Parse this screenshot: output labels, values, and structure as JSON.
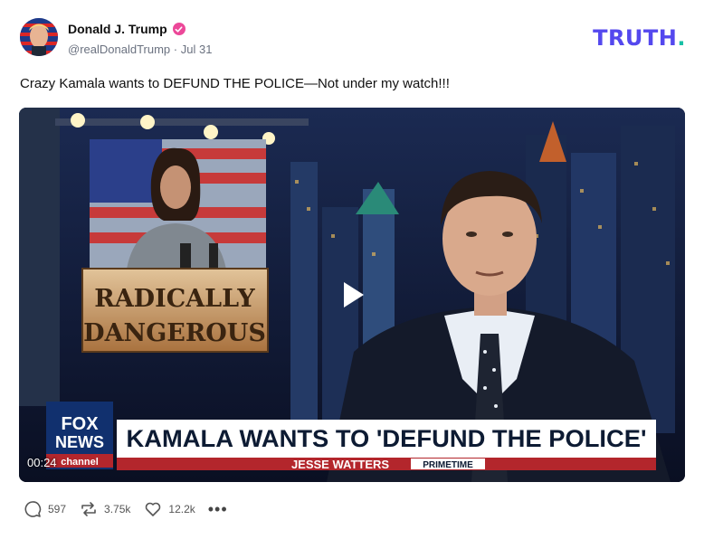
{
  "author": {
    "display_name": "Donald J. Trump",
    "handle": "@realDonaldTrump",
    "separator": "·",
    "date": "Jul 31"
  },
  "brand": {
    "wordmark": "TRUTH",
    "dot": "."
  },
  "post": {
    "text": "Crazy Kamala wants to DEFUND THE POLICE—Not under my watch!!!"
  },
  "video": {
    "duration": "00:24",
    "sign_line1": "RADICALLY",
    "sign_line2": "DANGEROUS",
    "network_line1": "FOX",
    "network_line2": "NEWS",
    "network_line3": "channel",
    "headline": "KAMALA WANTS TO 'DEFUND THE POLICE'",
    "show_name": "JESSE WATTERS",
    "show_tag": "PRIMETIME"
  },
  "engagement": {
    "replies": "597",
    "retruths": "3.75k",
    "likes": "12.2k",
    "more": "•••"
  },
  "colors": {
    "brand_purple": "#5448ee",
    "brand_teal": "#18c0a6",
    "verified_pink": "#ec4899"
  },
  "icons": [
    "verified-badge-icon",
    "play-icon",
    "reply-icon",
    "retruth-icon",
    "like-icon",
    "more-icon"
  ]
}
